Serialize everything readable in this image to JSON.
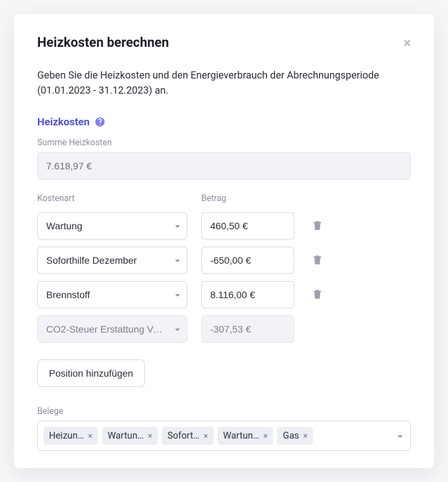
{
  "modal": {
    "title": "Heizkosten berechnen",
    "intro": "Geben Sie die Heizkosten und den Energieverbrauch der Abrechnungsperiode (01.01.2023 - 31.12.2023) an."
  },
  "section": {
    "title": "Heizkosten"
  },
  "sum": {
    "label": "Summe Heizkosten",
    "value": "7.618,97 €"
  },
  "columns": {
    "type": "Kostenart",
    "amount": "Betrag"
  },
  "rows": [
    {
      "type": "Wartung",
      "amount": "460,50 €",
      "deletable": true,
      "readonly": false
    },
    {
      "type": "Soforthilfe Dezember",
      "amount": "-650,00 €",
      "deletable": true,
      "readonly": false
    },
    {
      "type": "Brennstoff",
      "amount": "8.116,00 €",
      "deletable": true,
      "readonly": false
    },
    {
      "type": "CO2-Steuer Erstattung Ve…",
      "amount": "-307,53 €",
      "deletable": false,
      "readonly": true
    }
  ],
  "add_button": "Position hinzufügen",
  "belege": {
    "label": "Belege",
    "chips": [
      "Heizun…",
      "Wartun…",
      "Sofort…",
      "Wartun…",
      "Gas"
    ]
  }
}
